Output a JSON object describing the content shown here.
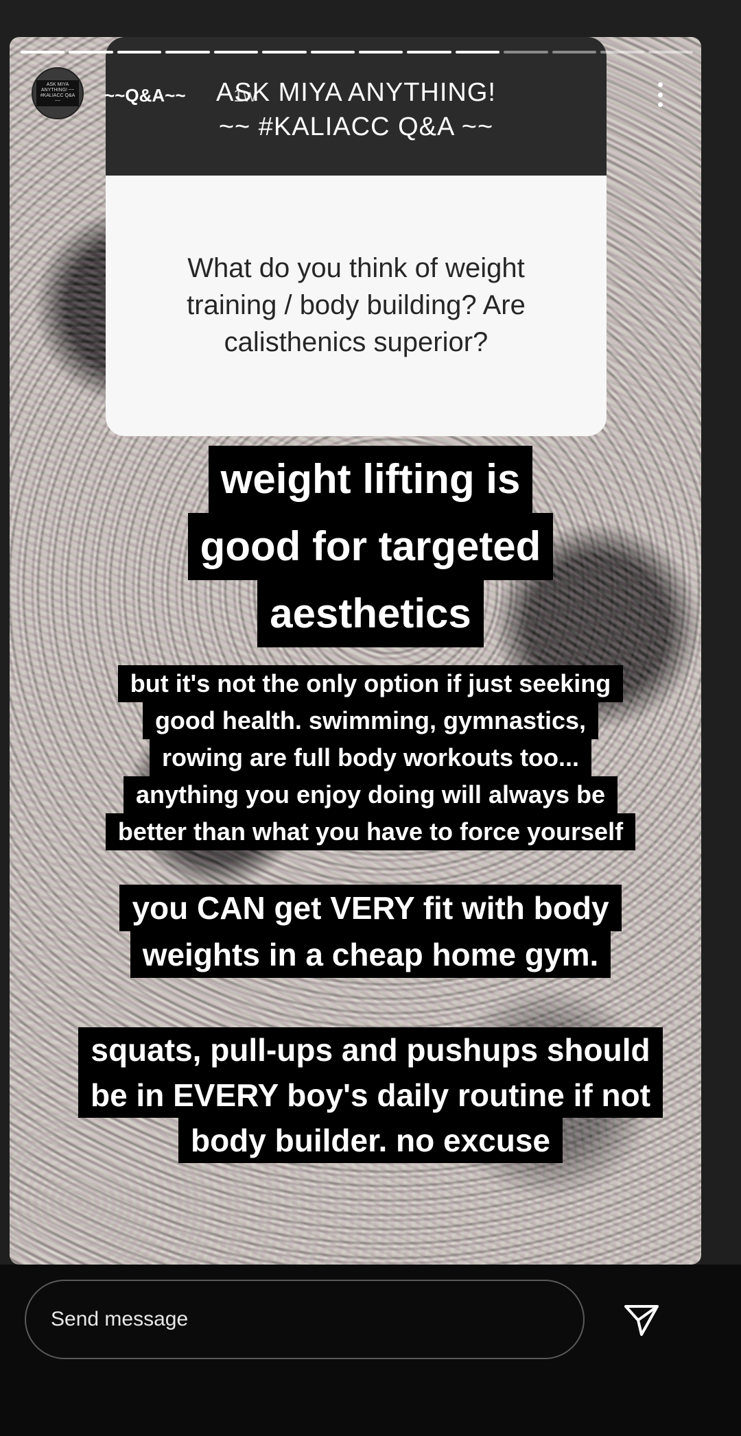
{
  "story": {
    "segments_total": 14,
    "segments_done": 10,
    "username": "~~Q&A~~",
    "timestamp": "1w",
    "avatar_caption": "ASK MIYA ANYTHING! ~~ #KALIACC Q&A ~~"
  },
  "question_sticker": {
    "header_line1": "ASK MIYA ANYTHING!",
    "header_line2": "~~ #KALIACC Q&A ~~",
    "question_line1": "What do you think of weight",
    "question_line2": "training / body building? Are",
    "question_line3": "calisthenics superior?"
  },
  "answer_blocks": {
    "block1": [
      "weight lifting is",
      "good for targeted",
      "aesthetics"
    ],
    "block2": [
      "but it's not the only option if just seeking",
      "good health. swimming, gymnastics,",
      "rowing are full body workouts too...",
      "anything you enjoy doing will always be",
      "better than what you have to force yourself"
    ],
    "block3": [
      "you CAN get VERY fit with body",
      "weights in a cheap home gym."
    ],
    "block4": [
      "squats, pull-ups and pushups should",
      "be in EVERY boy's daily routine if not",
      "body builder. no excuse"
    ]
  },
  "footer": {
    "message_placeholder": "Send message",
    "send_icon": "paper-plane-icon"
  },
  "colors": {
    "sticker_header_bg": "#2b2b2b",
    "sticker_body_bg": "#f7f7f7",
    "text_block_bg": "#000000",
    "bottom_bar_bg": "#0b0b0b"
  }
}
